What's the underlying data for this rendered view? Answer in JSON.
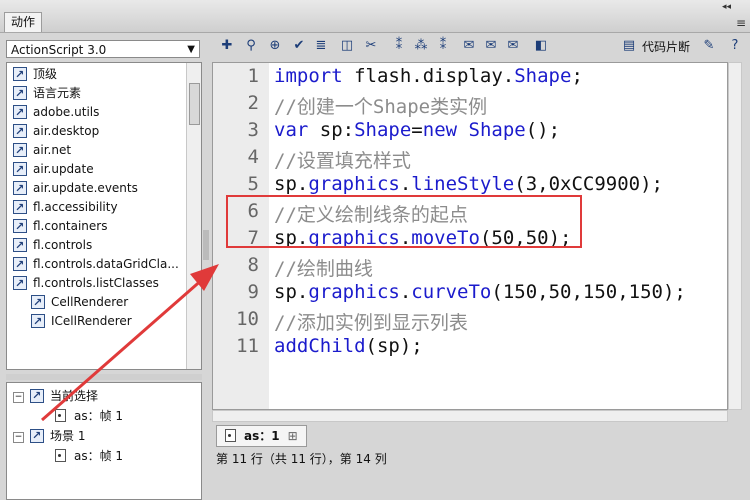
{
  "panel": {
    "tab_label": "动作",
    "collapse_glyph": "◂◂",
    "close_glyph": "≡"
  },
  "left": {
    "version_select": "ActionScript 3.0",
    "tree_items": [
      {
        "label": "顶级"
      },
      {
        "label": "语言元素"
      },
      {
        "label": "adobe.utils"
      },
      {
        "label": "air.desktop"
      },
      {
        "label": "air.net"
      },
      {
        "label": "air.update"
      },
      {
        "label": "air.update.events"
      },
      {
        "label": "fl.accessibility"
      },
      {
        "label": "fl.containers"
      },
      {
        "label": "fl.controls"
      },
      {
        "label": "fl.controls.dataGridCla..."
      },
      {
        "label": "fl.controls.listClasses"
      },
      {
        "label": "CellRenderer"
      },
      {
        "label": "ICellRenderer"
      }
    ],
    "lower": {
      "current": "当前选择",
      "current_child": "as：帧 1",
      "scene": "场景 1",
      "scene_child": "as：帧 1"
    }
  },
  "toolbar": {
    "code_snippets": "代码片断"
  },
  "editor": {
    "line_numbers": [
      "1",
      "2",
      "3",
      "4",
      "5",
      "6",
      "7",
      "8",
      "9",
      "10",
      "11"
    ]
  },
  "bottom_tab": "as：1",
  "status": "第 11 行（共 11 行），第 14 列"
}
